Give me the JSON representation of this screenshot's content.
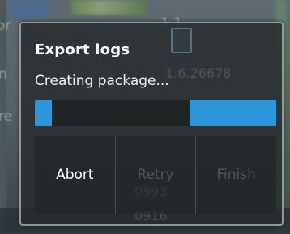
{
  "dialog": {
    "title": "Export logs",
    "message": "Creating package...",
    "progress": 0.07,
    "buttons": [
      {
        "label": "Abort",
        "enabled": true
      },
      {
        "label": "Retry",
        "enabled": false
      },
      {
        "label": "Finish",
        "enabled": false
      }
    ]
  },
  "background": {
    "value_1": "1.1",
    "value_2": "1.6.26678",
    "label_connection": "connection",
    "value_3": "0993",
    "value_4": "0916"
  },
  "colors": {
    "accent": "#2c96d9",
    "dialog_bg": "#282c2e"
  }
}
